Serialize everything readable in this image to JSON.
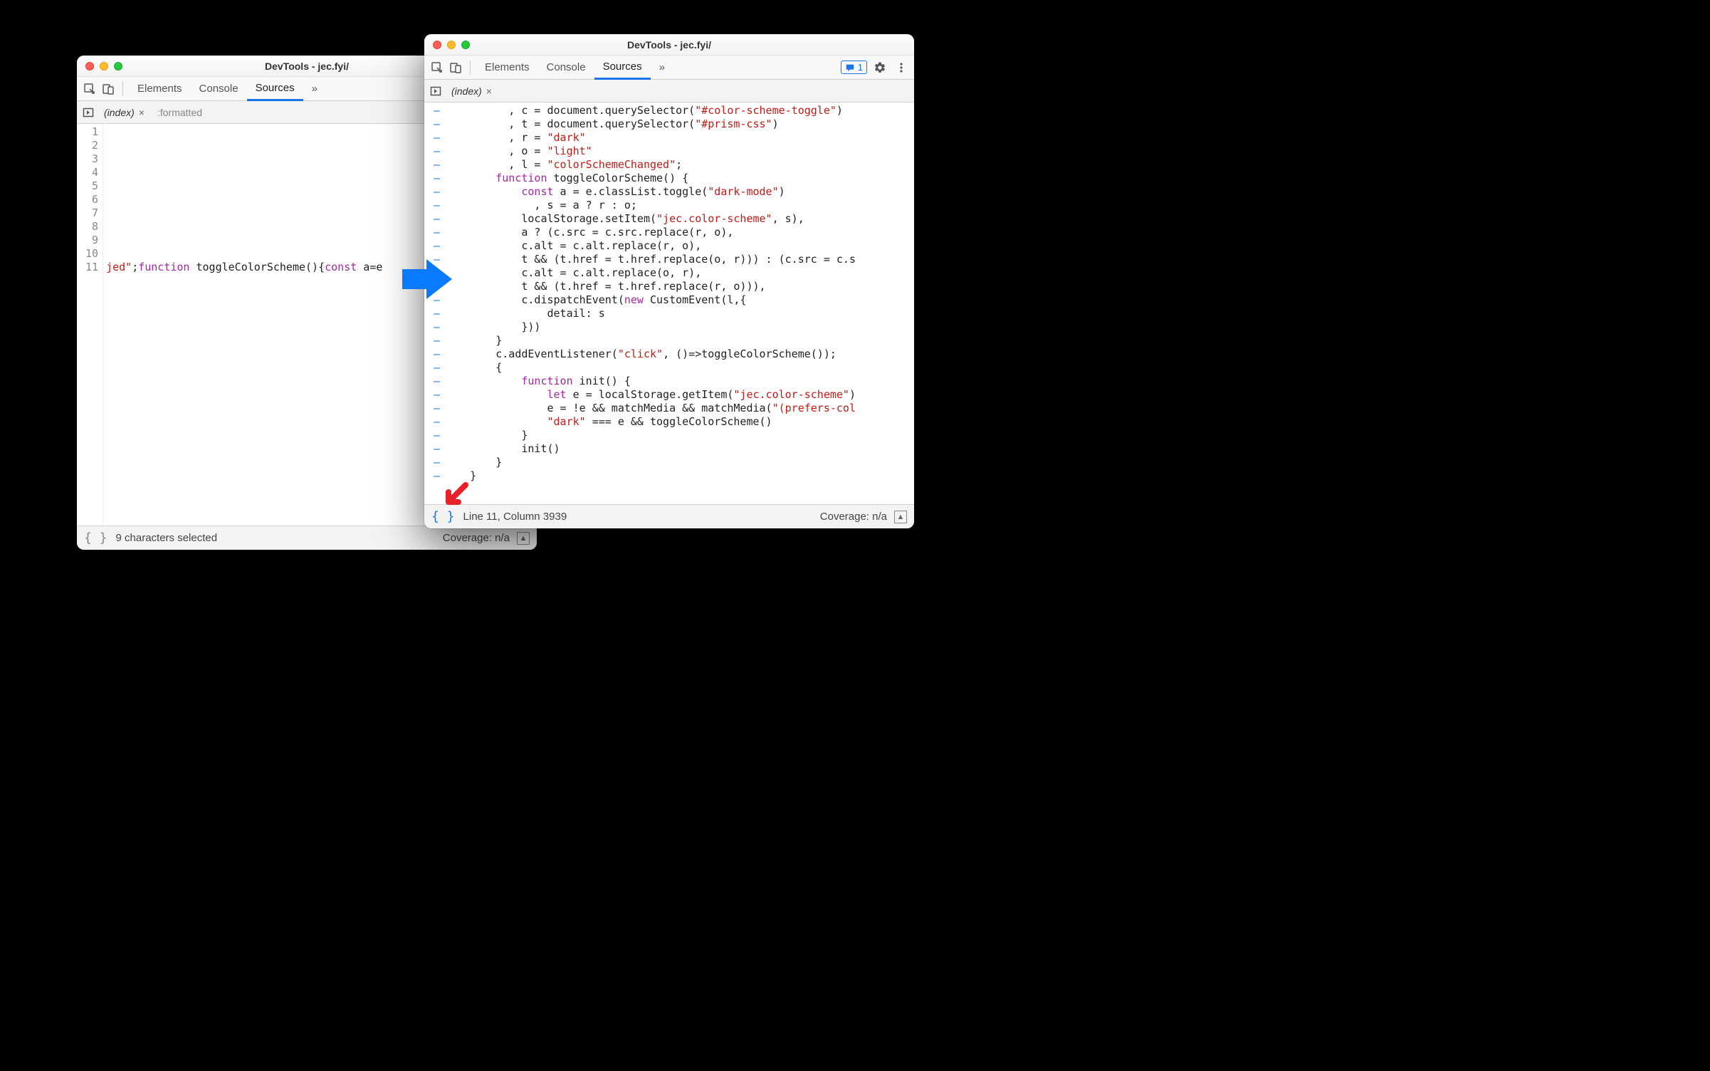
{
  "title": "DevTools - jec.fyi/",
  "toolbar_tabs": {
    "elements": "Elements",
    "console": "Console",
    "sources": "Sources"
  },
  "more_glyph": "»",
  "issues_count": "1",
  "left": {
    "file_name": "(index)",
    "formatted_label": ":formatted",
    "gutter_lines": [
      "1",
      "2",
      "3",
      "4",
      "5",
      "6",
      "7",
      "8",
      "9",
      "10",
      "11"
    ],
    "code_prefix": "jed\"",
    "code_kw1": "function",
    "code_fn": " toggleColorScheme(){",
    "code_kw2": "const",
    "code_after": " a=e",
    "status_left": "9 characters selected",
    "coverage": "Coverage: n/a"
  },
  "right": {
    "file_name": "(index)",
    "code_lines": [
      [
        [
          "op",
          "          , c = document.querySelector("
        ],
        [
          "str",
          "\"#color-scheme-toggle\""
        ],
        [
          "op",
          ")"
        ]
      ],
      [
        [
          "op",
          "          , t = document.querySelector("
        ],
        [
          "str",
          "\"#prism-css\""
        ],
        [
          "op",
          ")"
        ]
      ],
      [
        [
          "op",
          "          , r = "
        ],
        [
          "str",
          "\"dark\""
        ]
      ],
      [
        [
          "op",
          "          , o = "
        ],
        [
          "str",
          "\"light\""
        ]
      ],
      [
        [
          "op",
          "          , l = "
        ],
        [
          "str",
          "\"colorSchemeChanged\""
        ],
        [
          "op",
          ";"
        ]
      ],
      [
        [
          "op",
          "        "
        ],
        [
          "kw",
          "function"
        ],
        [
          "op",
          " toggleColorScheme() {"
        ]
      ],
      [
        [
          "op",
          "            "
        ],
        [
          "kw",
          "const"
        ],
        [
          "op",
          " a = e.classList.toggle("
        ],
        [
          "str",
          "\"dark-mode\""
        ],
        [
          "op",
          ")"
        ]
      ],
      [
        [
          "op",
          "              , s = a ? r : o;"
        ]
      ],
      [
        [
          "op",
          "            localStorage.setItem("
        ],
        [
          "str",
          "\"jec.color-scheme\""
        ],
        [
          "op",
          ", s),"
        ]
      ],
      [
        [
          "op",
          "            a ? (c.src = c.src.replace(r, o),"
        ]
      ],
      [
        [
          "op",
          "            c.alt = c.alt.replace(r, o),"
        ]
      ],
      [
        [
          "op",
          "            t && (t.href = t.href.replace(o, r))) : (c.src = c.s"
        ]
      ],
      [
        [
          "op",
          "            c.alt = c.alt.replace(o, r),"
        ]
      ],
      [
        [
          "op",
          "            t && (t.href = t.href.replace(r, o))),"
        ]
      ],
      [
        [
          "op",
          "            c.dispatchEvent("
        ],
        [
          "kw",
          "new"
        ],
        [
          "op",
          " CustomEvent(l,{"
        ]
      ],
      [
        [
          "op",
          "                detail: s"
        ]
      ],
      [
        [
          "op",
          "            }))"
        ]
      ],
      [
        [
          "op",
          "        }"
        ]
      ],
      [
        [
          "op",
          "        c.addEventListener("
        ],
        [
          "str",
          "\"click\""
        ],
        [
          "op",
          ", ()=>toggleColorScheme());"
        ]
      ],
      [
        [
          "op",
          "        {"
        ]
      ],
      [
        [
          "op",
          "            "
        ],
        [
          "kw",
          "function"
        ],
        [
          "op",
          " init() {"
        ]
      ],
      [
        [
          "op",
          "                "
        ],
        [
          "kw",
          "let"
        ],
        [
          "op",
          " e = localStorage.getItem("
        ],
        [
          "str",
          "\"jec.color-scheme\""
        ],
        [
          "op",
          ")"
        ]
      ],
      [
        [
          "op",
          "                e = !e && matchMedia && matchMedia("
        ],
        [
          "str",
          "\"(prefers-col"
        ]
      ],
      [
        [
          "op",
          "                "
        ],
        [
          "str",
          "\"dark\""
        ],
        [
          "op",
          " === e && toggleColorScheme()"
        ]
      ],
      [
        [
          "op",
          "            }"
        ]
      ],
      [
        [
          "op",
          "            init()"
        ]
      ],
      [
        [
          "op",
          "        }"
        ]
      ],
      [
        [
          "op",
          "    }"
        ]
      ]
    ],
    "status_left": "Line 11, Column 3939",
    "coverage": "Coverage: n/a"
  }
}
